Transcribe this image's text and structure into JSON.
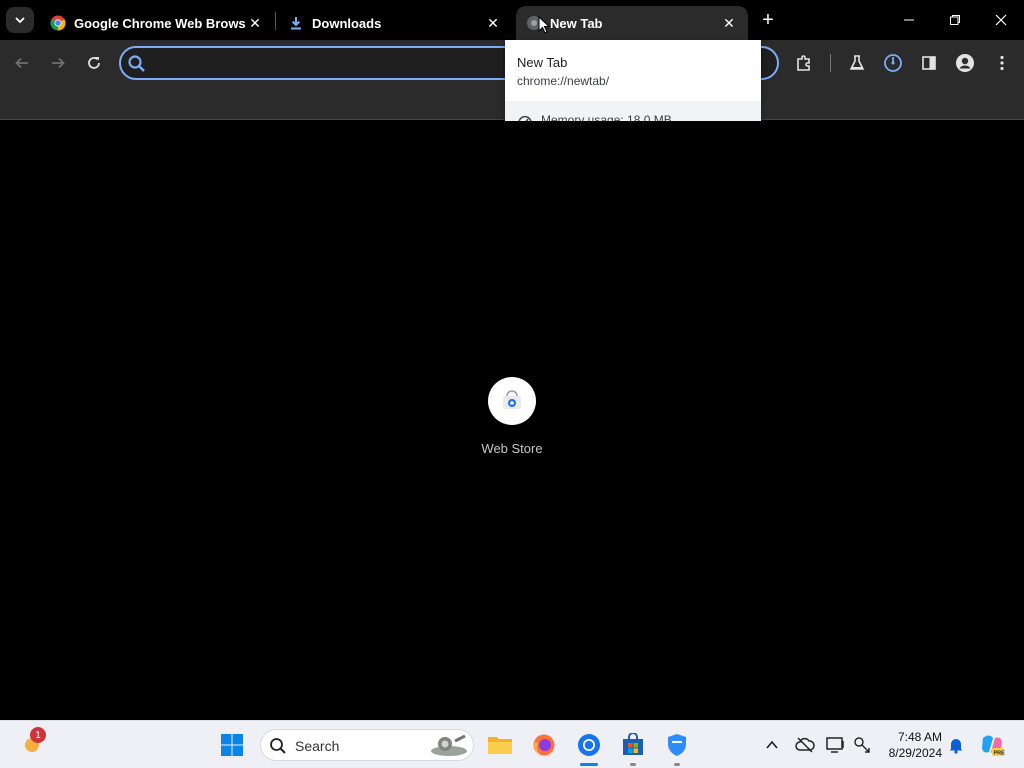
{
  "tabs": [
    {
      "title": "Google Chrome Web Browser",
      "icon": "chrome-icon"
    },
    {
      "title": "Downloads",
      "icon": "download-icon"
    },
    {
      "title": "New Tab",
      "icon": "newtab-icon",
      "active": true
    }
  ],
  "omnibox": {
    "value": "",
    "placeholder": ""
  },
  "hovercard": {
    "title": "New Tab",
    "url": "chrome://newtab/",
    "memory": "Memory usage: 18.0 MB"
  },
  "shortcuts": [
    {
      "label": "Web Store",
      "icon": "webstore-icon"
    }
  ],
  "taskbar": {
    "search_placeholder": "Search",
    "time": "7:48 AM",
    "date": "8/29/2024",
    "weather_badge": "1"
  },
  "colors": {
    "accent": "#7cacf8",
    "toolbar": "#2b2b2b",
    "content_bg": "#000000",
    "taskbar": "#eef0f6"
  }
}
